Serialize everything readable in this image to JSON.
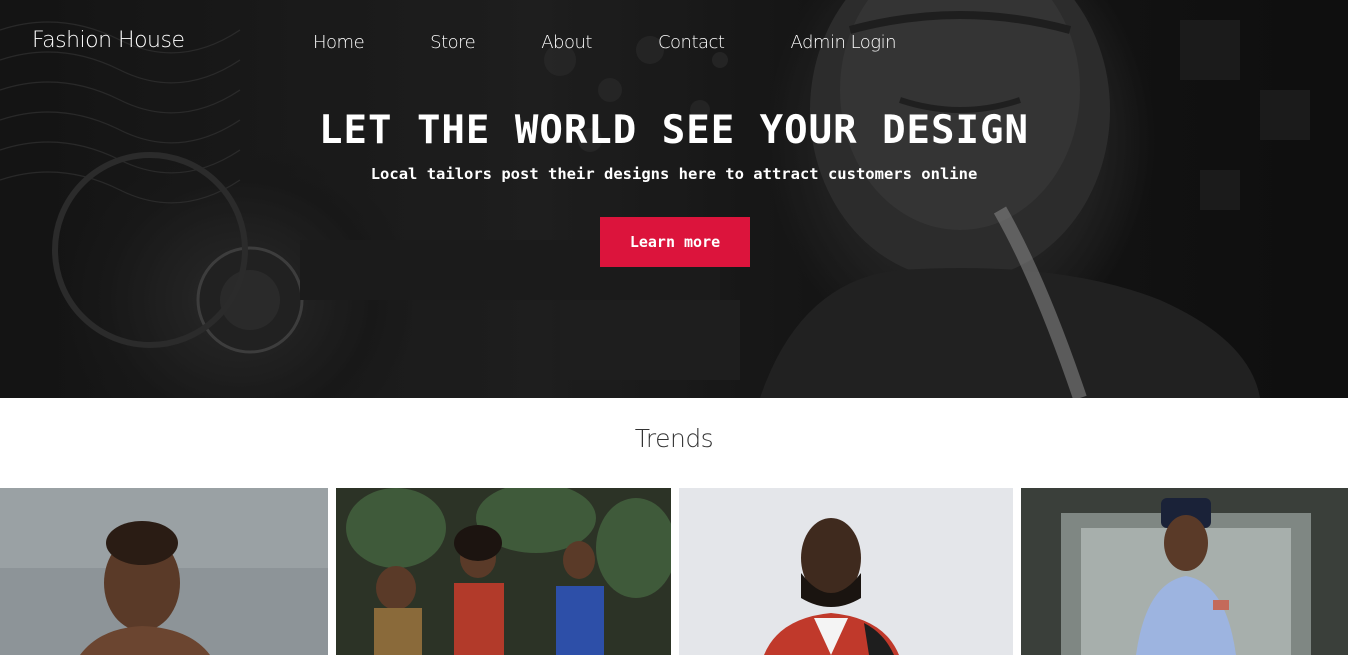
{
  "brand": "Fashion House",
  "nav": [
    "Home",
    "Store",
    "About",
    "Contact",
    "Admin Login"
  ],
  "hero": {
    "title": "LET THE WORLD SEE YOUR DESIGN",
    "subtitle": "Local tailors post their designs here to attract customers online",
    "button": "Learn more"
  },
  "trends": {
    "title": "Trends"
  },
  "colors": {
    "accent": "#dc143c",
    "hero_overlay": "#1c1c1c"
  }
}
